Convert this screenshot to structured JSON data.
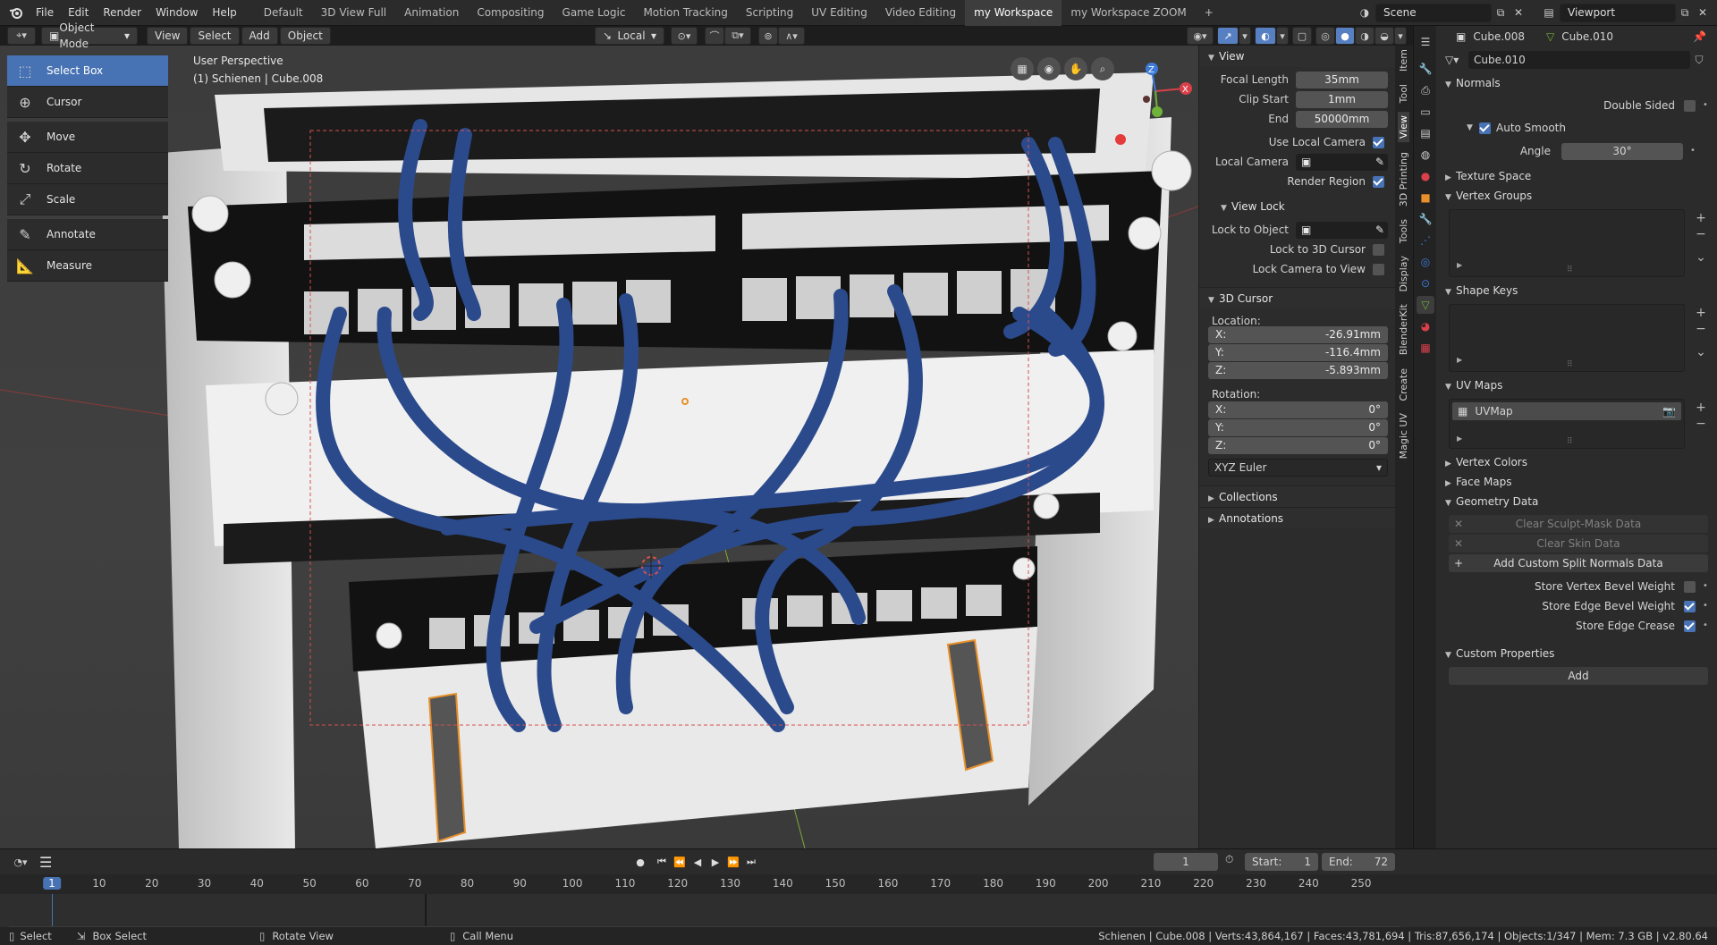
{
  "menu": {
    "items": [
      "File",
      "Edit",
      "Render",
      "Window",
      "Help"
    ]
  },
  "workspaces": {
    "tabs": [
      "Default",
      "3D View Full",
      "Animation",
      "Compositing",
      "Game Logic",
      "Motion Tracking",
      "Scripting",
      "UV Editing",
      "Video Editing",
      "my Workspace",
      "my Workspace ZOOM"
    ],
    "active_index": 9,
    "add": "+"
  },
  "scene": {
    "name": "Scene"
  },
  "viewlayer": {
    "name": "Viewport"
  },
  "viewport_header": {
    "mode": "Object Mode",
    "menus": [
      "View",
      "Select",
      "Add",
      "Object"
    ],
    "transform_orientation": "Local"
  },
  "viewport": {
    "perspective": "User Perspective",
    "object_info": "(1) Schienen | Cube.008"
  },
  "toolbar": {
    "tools": [
      {
        "label": "Select Box",
        "icon": "select-box-icon",
        "active": true
      },
      {
        "label": "Cursor",
        "icon": "cursor-icon"
      },
      {
        "label": "Move",
        "icon": "move-icon"
      },
      {
        "label": "Rotate",
        "icon": "rotate-icon"
      },
      {
        "label": "Scale",
        "icon": "scale-icon"
      },
      {
        "label": "Annotate",
        "icon": "annotate-icon"
      },
      {
        "label": "Measure",
        "icon": "measure-icon"
      }
    ]
  },
  "npanel": {
    "view": {
      "title": "View",
      "focal_length_label": "Focal Length",
      "focal_length": "35mm",
      "clip_start_label": "Clip Start",
      "clip_start": "1mm",
      "end_label": "End",
      "end": "50000mm",
      "use_local_camera_label": "Use Local Camera",
      "local_camera_label": "Local Camera",
      "render_region_label": "Render Region"
    },
    "view_lock": {
      "title": "View Lock",
      "lock_to_object_label": "Lock to Object",
      "lock_to_3d_cursor_label": "Lock to 3D Cursor",
      "lock_camera_to_view_label": "Lock Camera to View"
    },
    "cursor": {
      "title": "3D Cursor",
      "location_label": "Location:",
      "x_label": "X:",
      "x": "-26.91mm",
      "y_label": "Y:",
      "y": "-116.4mm",
      "z_label": "Z:",
      "z": "-5.893mm",
      "rotation_label": "Rotation:",
      "rx": "0°",
      "ry": "0°",
      "rz": "0°",
      "rotation_mode": "XYZ Euler"
    },
    "collections": {
      "title": "Collections"
    },
    "annotations": {
      "title": "Annotations"
    }
  },
  "sidebar_tabs": [
    "Item",
    "Tool",
    "View",
    "3D Printing",
    "Tools",
    "Display",
    "BlenderKit",
    "Create",
    "Magic UV"
  ],
  "properties": {
    "object": "Cube.008",
    "mesh": "Cube.010",
    "data_name": "Cube.010",
    "normals": {
      "title": "Normals",
      "double_sided": "Double Sided",
      "auto_smooth": "Auto Smooth",
      "angle_label": "Angle",
      "angle": "30°"
    },
    "texture_space": "Texture Space",
    "vertex_groups": "Vertex Groups",
    "shape_keys": "Shape Keys",
    "uv_maps": {
      "title": "UV Maps",
      "item": "UVMap"
    },
    "vertex_colors": "Vertex Colors",
    "face_maps": "Face Maps",
    "geometry_data": {
      "title": "Geometry Data",
      "clear_sculpt": "Clear Sculpt-Mask Data",
      "clear_skin": "Clear Skin Data",
      "add_split_normals": "Add Custom Split Normals Data",
      "store_vertex_bevel": "Store Vertex Bevel Weight",
      "store_edge_bevel": "Store Edge Bevel Weight",
      "store_edge_crease": "Store Edge Crease"
    },
    "custom_properties": {
      "title": "Custom Properties",
      "add": "Add"
    }
  },
  "timeline": {
    "current_frame": "1",
    "start_label": "Start:",
    "start": "1",
    "end_label": "End:",
    "end": "72",
    "ticks": [
      "1",
      "10",
      "20",
      "30",
      "40",
      "50",
      "60",
      "70",
      "80",
      "90",
      "100",
      "110",
      "120",
      "130",
      "140",
      "150",
      "160",
      "170",
      "180",
      "190",
      "200",
      "210",
      "220",
      "230",
      "240",
      "250"
    ]
  },
  "statusbar": {
    "select": "Select",
    "box_select": "Box Select",
    "rotate_view": "Rotate View",
    "call_menu": "Call Menu",
    "stats": "Schienen | Cube.008 | Verts:43,864,167 | Faces:43,781,694 | Tris:87,656,174 | Objects:1/347 | Mem: 7.3 GB | v2.80.64"
  },
  "colors": {
    "accent": "#4772b3",
    "cable": "#2b4a8c",
    "selection_outline": "#e8902b",
    "axis_x": "#d9404a",
    "axis_y": "#6fb33a",
    "axis_z": "#3d7bd9"
  }
}
